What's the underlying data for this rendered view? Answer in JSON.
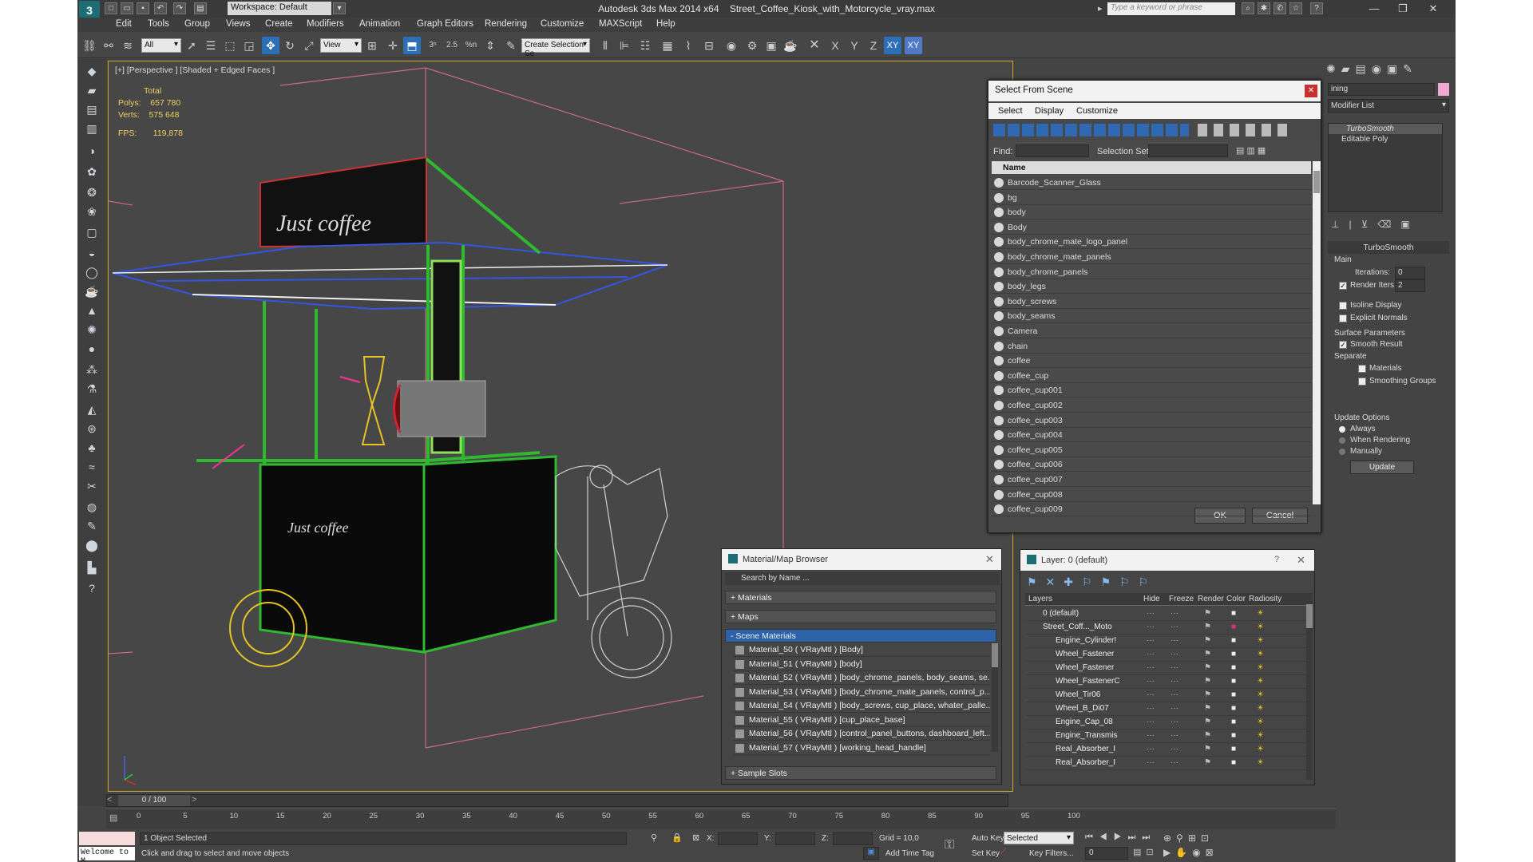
{
  "title": {
    "app": "Autodesk 3ds Max  2014 x64",
    "file": "Street_Coffee_Kiosk_with_Motorcycle_vray.max",
    "workspace": "Workspace: Default",
    "search_placeholder": "Type a keyword or phrase"
  },
  "menu": [
    "Edit",
    "Tools",
    "Group",
    "Views",
    "Create",
    "Modifiers",
    "Animation",
    "Graph Editors",
    "Rendering",
    "Customize",
    "MAXScript",
    "Help"
  ],
  "toolbar": {
    "selection_filter": "All",
    "ref_coord": "View",
    "named_sel": "Create Selection Se",
    "axis_x": "X",
    "axis_y": "Y",
    "axis_z": "Z",
    "axis_xy": "XY",
    "axis_xy2": "XY",
    "angle_snap": "2.5",
    "percent_snap": "%n"
  },
  "viewport": {
    "label": "[+] [Perspective ] [Shaded + Edged Faces ]",
    "stats_total": "Total",
    "polys_label": "Polys:",
    "polys": "657 780",
    "verts_label": "Verts:",
    "verts": "575 648",
    "fps_label": "FPS:",
    "fps": "119,878",
    "sign_text": "Just coffee",
    "cart_text": "Just coffee"
  },
  "select_dialog": {
    "title": "Select From Scene",
    "tabs": [
      "Select",
      "Display",
      "Customize"
    ],
    "find_label": "Find:",
    "selset_label": "Selection Set:",
    "col_name": "Name",
    "items": [
      "Barcode_Scanner_Glass",
      "bg",
      "body",
      "Body",
      "body_chrome_mate_logo_panel",
      "body_chrome_mate_panels",
      "body_chrome_panels",
      "body_legs",
      "body_screws",
      "body_seams",
      "Camera",
      "chain",
      "coffee",
      "coffee_cup",
      "coffee_cup001",
      "coffee_cup002",
      "coffee_cup003",
      "coffee_cup004",
      "coffee_cup005",
      "coffee_cup006",
      "coffee_cup007",
      "coffee_cup008",
      "coffee_cup009"
    ],
    "ok": "OK",
    "cancel": "Cancel"
  },
  "material_browser": {
    "title": "Material/Map Browser",
    "search_placeholder": "Search by Name ...",
    "sec_materials": "+ Materials",
    "sec_maps": "+ Maps",
    "sec_scene": "- Scene Materials",
    "sec_slots": "+ Sample Slots",
    "items": [
      "Material_50  ( VRayMtl ) [Body]",
      "Material_51  ( VRayMtl ) [body]",
      "Material_52  ( VRayMtl ) [body_chrome_panels, body_seams, se...",
      "Material_53  ( VRayMtl ) [body_chrome_mate_panels, control_p...",
      "Material_54  ( VRayMtl ) [body_screws, cup_place, whater_palle...",
      "Material_55  ( VRayMtl ) [cup_place_base]",
      "Material_56  ( VRayMtl ) [control_panel_buttons, dashboard_left...",
      "Material_57  ( VRayMtl ) [working_head_handle]"
    ]
  },
  "layer_dialog": {
    "title": "Layer: 0 (default)",
    "help": "?",
    "cols": [
      "Layers",
      "Hide",
      "Freeze",
      "Render",
      "Color",
      "Radiosity"
    ],
    "items": [
      "0 (default)",
      "Street_Coff..._Moto",
      "Engine_Cylinder!",
      "Wheel_Fastener",
      "Wheel_Fastener",
      "Wheel_FastenerC",
      "Wheel_Tir06",
      "Wheel_B_Di07",
      "Engine_Cap_08",
      "Engine_Transmis",
      "Real_Absorber_I",
      "Real_Absorber_I"
    ]
  },
  "command_panel": {
    "name_field": "ining",
    "modifier_list": "Modifier List",
    "stack": [
      "TurboSmooth",
      "Editable Poly"
    ],
    "rollout": "TurboSmooth",
    "main": "Main",
    "iterations_label": "Iterations:",
    "iterations": "0",
    "render_iters_label": "Render Iters:",
    "render_iters": "2",
    "isoline": "Isoline Display",
    "explicit": "Explicit Normals",
    "surface": "Surface Parameters",
    "smooth": "Smooth Result",
    "separate": "Separate",
    "materials": "Materials",
    "smoothing": "Smoothing Groups",
    "update_options": "Update Options",
    "always": "Always",
    "when_rendering": "When Rendering",
    "manually": "Manually",
    "update": "Update"
  },
  "timeline": {
    "frame": "0 / 100",
    "ticks": [
      "0",
      "5",
      "10",
      "15",
      "20",
      "25",
      "30",
      "35",
      "40",
      "45",
      "50",
      "55",
      "60",
      "65",
      "70",
      "75",
      "80",
      "85",
      "90",
      "95",
      "100"
    ]
  },
  "status": {
    "welcome": "Welcome to M",
    "selected": "1 Object Selected",
    "prompt": "Click and drag to select and move objects",
    "x": "X:",
    "y": "Y:",
    "z": "Z:",
    "grid": "Grid = 10,0",
    "auto_key": "Auto Key",
    "selected_dd": "Selected",
    "add_time_tag": "Add Time Tag",
    "set_key": "Set Key",
    "key_filters": "Key Filters...",
    "frame_field": "0"
  }
}
